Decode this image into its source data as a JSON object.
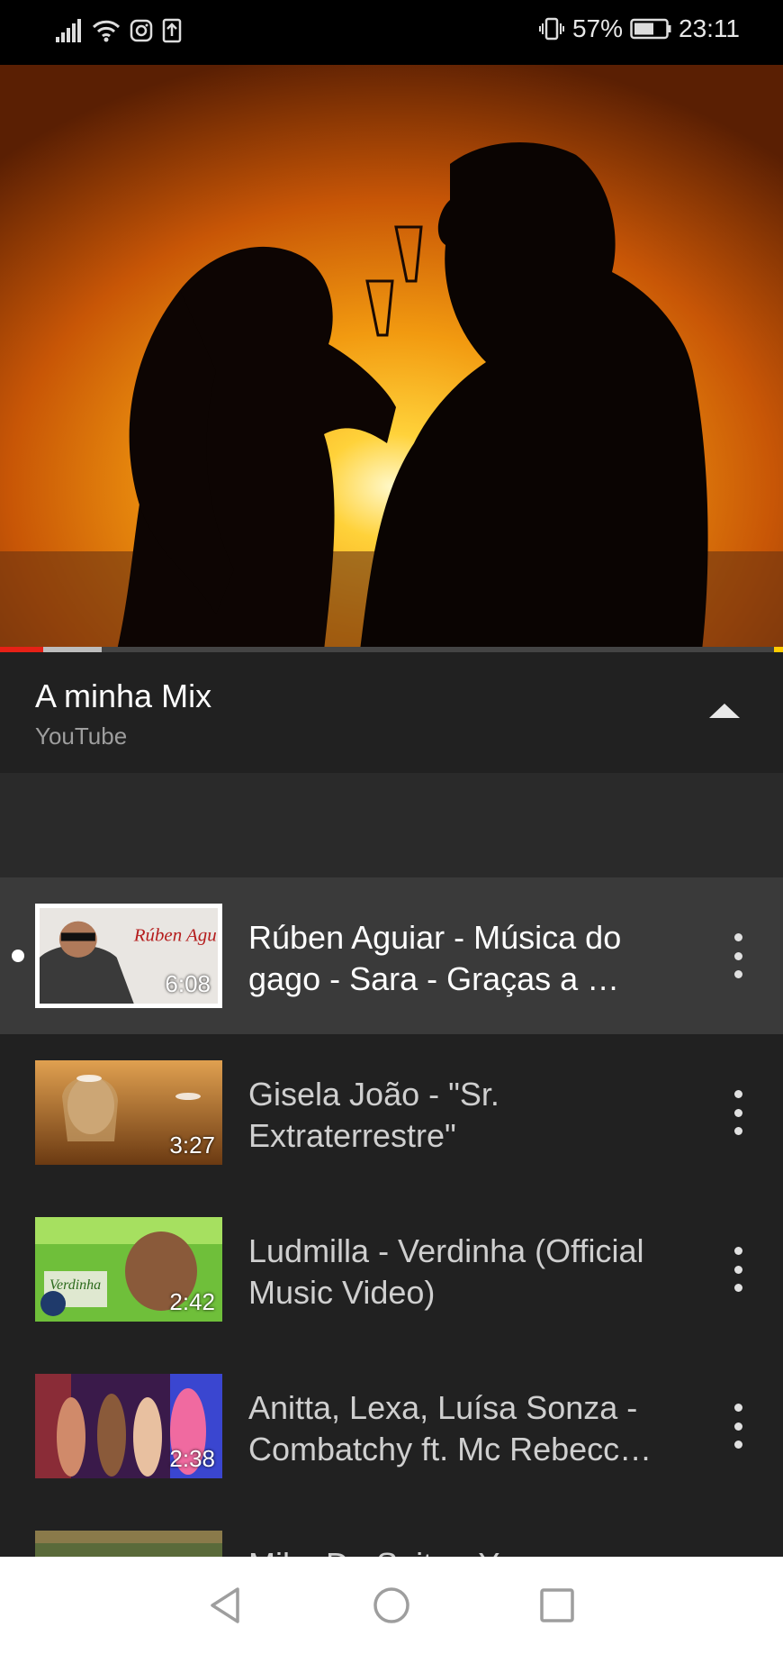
{
  "status_bar": {
    "icons_left": [
      "signal-icon",
      "wifi-icon",
      "instagram-icon",
      "upload-icon"
    ],
    "icons_right": [
      "vibrate-icon",
      "battery-icon"
    ],
    "battery": "57%",
    "time": "23:11"
  },
  "player": {
    "progress_played": 0.055,
    "progress_buffered": 0.13
  },
  "playlist": {
    "title": "A minha Mix",
    "subtitle": "YouTube",
    "collapse_icon": "chevron-up-icon"
  },
  "items": [
    {
      "title": "Rúben Aguiar - Música do gago - Sara - Graças a …",
      "duration": "6:08",
      "thumb_text": "Rúben Aguiar",
      "active": true
    },
    {
      "title": "Gisela João - \"Sr. Extraterrestre\"",
      "duration": "3:27",
      "active": false
    },
    {
      "title": "Ludmilla - Verdinha (Official Music Video)",
      "duration": "2:42",
      "thumb_text": "Verdinha",
      "active": false
    },
    {
      "title": "Anitta, Lexa, Luísa Sonza - Combatchy ft. Mc Rebecc…",
      "duration": "2:38",
      "active": false
    },
    {
      "title": "Mika De Saito - Y",
      "duration": "",
      "active": false
    }
  ],
  "nav": [
    "back-icon",
    "home-icon",
    "recents-icon"
  ],
  "colors": {
    "accent": "#e62117",
    "background": "#212121",
    "active_row": "#3a3a3a"
  }
}
